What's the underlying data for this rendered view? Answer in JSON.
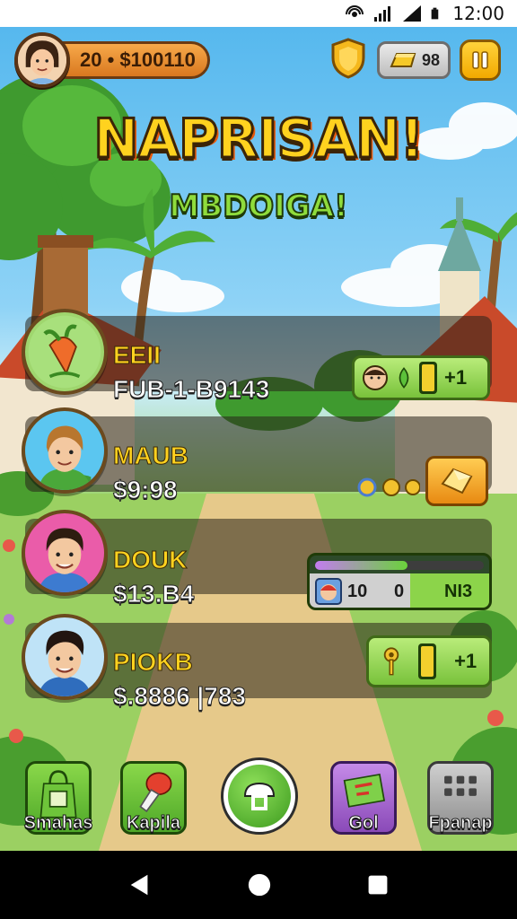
{
  "status_bar": {
    "time": "12:00"
  },
  "hud": {
    "player_stat": "20 • $100110",
    "gold_count": "98"
  },
  "title": "NAPRISAN!",
  "subtitle": "MBDOIGA!",
  "leaderboard": [
    {
      "name": "EEII",
      "value": "FUB-1-B9143",
      "reward": "+1"
    },
    {
      "name": "MAUB",
      "value": "$9:98"
    },
    {
      "name": "DOUK",
      "value": "$13.B4",
      "panel_left": "10",
      "panel_mid": "0",
      "panel_right": "NI3",
      "progress": 0.55
    },
    {
      "name": "PIOKB",
      "value": "$.8886 |783",
      "reward": "+1"
    }
  ],
  "menu": [
    {
      "label": "Smahas"
    },
    {
      "label": "Kapila"
    },
    {
      "label": ""
    },
    {
      "label": "Gol"
    },
    {
      "label": "Fpanap"
    }
  ],
  "colors": {
    "title": "#ffd21f",
    "subtitle": "#8fdc3c",
    "panel_green": "#79c23b",
    "hud_orange": "#d9781f",
    "pause_yellow": "#f2a900"
  }
}
